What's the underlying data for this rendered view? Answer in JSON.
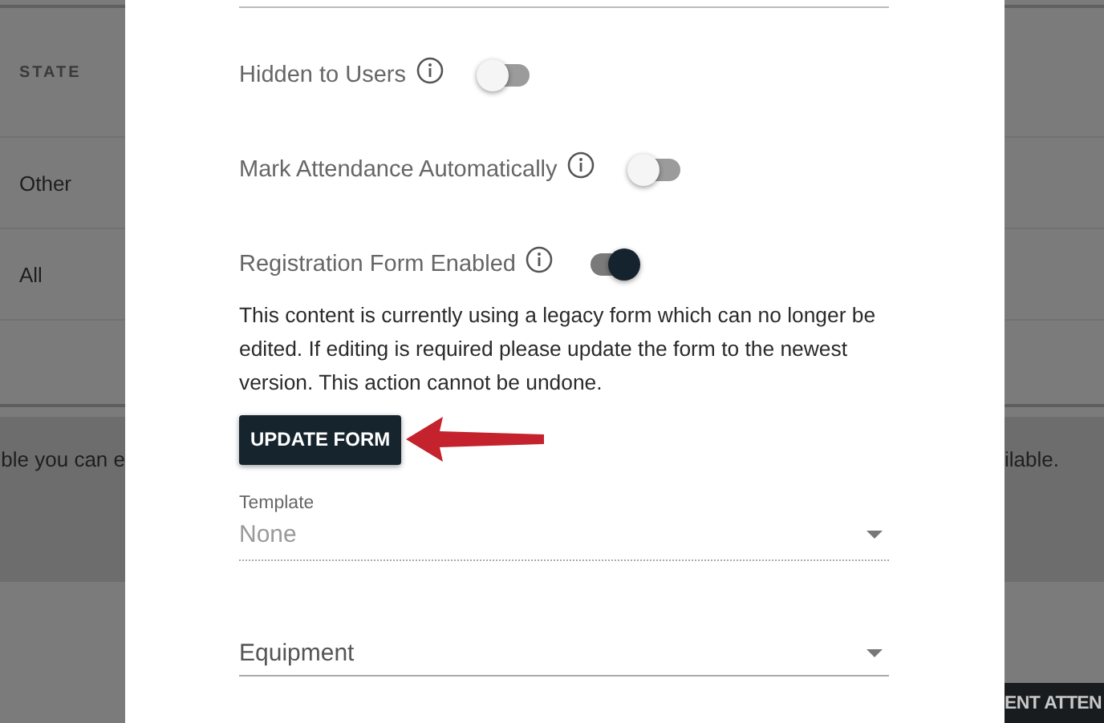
{
  "background": {
    "table": {
      "columns": [
        "STATE"
      ],
      "rows": [
        [
          "Other"
        ],
        [
          "All"
        ]
      ]
    },
    "notice_left": "ble you can e",
    "notice_right": "ilable.",
    "footer_button": "ENT ATTEN"
  },
  "dialog": {
    "toggles": [
      {
        "label": "Hidden to Users",
        "on": false
      },
      {
        "label": "Mark Attendance Automatically",
        "on": false
      },
      {
        "label": "Registration Form Enabled",
        "on": true
      }
    ],
    "legacy_notice": "This content is currently using a legacy form which can no longer be edited. If editing is required please update the form to the newest version. This action cannot be undone.",
    "update_button": "UPDATE FORM",
    "template": {
      "label": "Template",
      "value": "None",
      "disabled": true
    },
    "equipment": {
      "placeholder": "Equipment"
    }
  }
}
